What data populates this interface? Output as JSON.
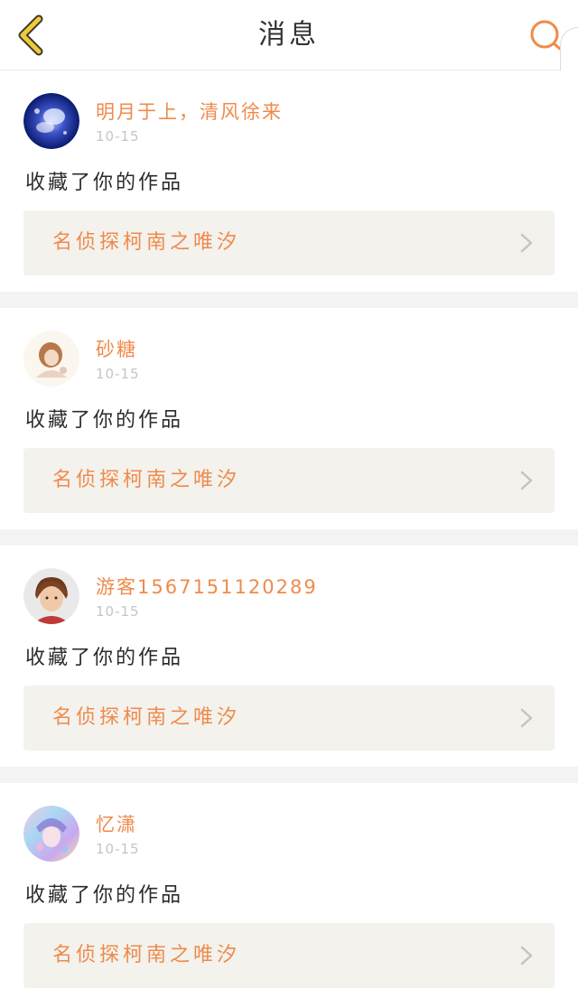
{
  "header": {
    "title": "消息",
    "back_icon": "chevron-left-icon",
    "search_icon": "search-icon",
    "accent": "#f0c93c",
    "search_color": "#f08a4b"
  },
  "messages": [
    {
      "username": "明月于上，清风徐来",
      "time": "10-15",
      "action": "收藏了你的作品",
      "work_title": "名侦探柯南之唯汐",
      "avatar": "avatar-blue-fantasy"
    },
    {
      "username": "砂糖",
      "time": "10-15",
      "action": "收藏了你的作品",
      "work_title": "名侦探柯南之唯汐",
      "avatar": "avatar-girl-sketch"
    },
    {
      "username": "游客1567151120289",
      "time": "10-15",
      "action": "收藏了你的作品",
      "work_title": "名侦探柯南之唯汐",
      "avatar": "avatar-short-hair"
    },
    {
      "username": "忆潇",
      "time": "10-15",
      "action": "收藏了你的作品",
      "work_title": "名侦探柯南之唯汐",
      "avatar": "avatar-colorful-anime"
    }
  ],
  "colors": {
    "username": "#f08a4b",
    "time": "#c5c5c5",
    "work_box_bg": "#f3f2ed",
    "divider": "#f3f3f3"
  }
}
